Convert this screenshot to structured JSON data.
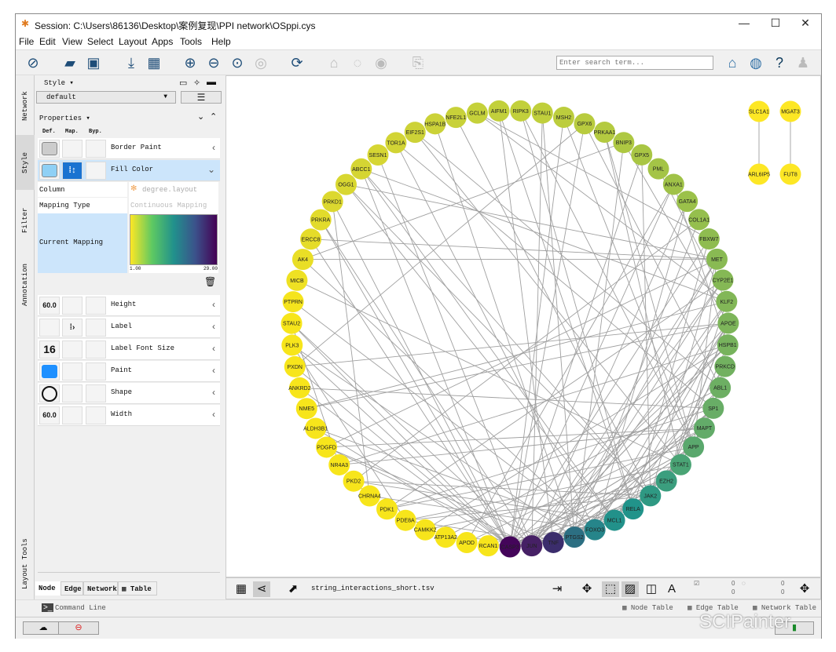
{
  "window": {
    "title": "Session: C:\\Users\\86136\\Desktop\\案例复现\\PPI network\\OSppi.cys",
    "minimize": "—",
    "maximize": "☐",
    "close": "✕"
  },
  "menu": [
    "File",
    "Edit",
    "View",
    "Select",
    "Layout",
    "Apps",
    "Tools",
    "Help"
  ],
  "search": {
    "placeholder": "Enter search term..."
  },
  "side_tabs": [
    "Network",
    "Style",
    "Filter",
    "Annotation",
    "Layout Tools"
  ],
  "style_panel": {
    "header": "Style ▾",
    "style_name": "default",
    "properties_label": "Properties ▾",
    "col_headers": [
      "Def.",
      "Map.",
      "Byp."
    ],
    "properties": [
      {
        "name": "Border Paint",
        "default": "",
        "default_color": "#cccccc"
      },
      {
        "name": "Fill Color",
        "default": "",
        "default_color": "#8fd0f5",
        "selected": true
      }
    ],
    "mapping": {
      "column_label": "Column",
      "column_value": "degree.layout",
      "type_label": "Mapping Type",
      "type_value": "Continuous Mapping",
      "current_label": "Current Mapping",
      "min": "1.00",
      "max": "29.00",
      "gradient": [
        "#fde725",
        "#5ec962",
        "#21918c",
        "#3b528b",
        "#440154"
      ]
    },
    "properties2": [
      {
        "name": "Height",
        "default": "60.0"
      },
      {
        "name": "Label",
        "default": ""
      },
      {
        "name": "Label Font Size",
        "default": "16"
      },
      {
        "name": "Paint",
        "default": "",
        "default_color": "#1e90ff"
      },
      {
        "name": "Shape",
        "default": ""
      },
      {
        "name": "Width",
        "default": "60.0"
      }
    ],
    "bottom_tabs": [
      "Node",
      "Edge",
      "Network",
      "Table"
    ]
  },
  "network": {
    "edge_color": "#a0a0a0",
    "circle_nodes": [
      {
        "n": "GCLM",
        "c": "#c5d13a"
      },
      {
        "n": "AIFM1",
        "c": "#c2d03b"
      },
      {
        "n": "RIPK3",
        "c": "#c2d03b"
      },
      {
        "n": "STAU1",
        "c": "#c0cf3c"
      },
      {
        "n": "MSH2",
        "c": "#bccd3d"
      },
      {
        "n": "GPX6",
        "c": "#b8cb3e"
      },
      {
        "n": "PRKAA1",
        "c": "#b4ca40"
      },
      {
        "n": "BNIP3",
        "c": "#aec842"
      },
      {
        "n": "GPX5",
        "c": "#a9c644"
      },
      {
        "n": "PML",
        "c": "#a4c446"
      },
      {
        "n": "ANXA1",
        "c": "#a0c248"
      },
      {
        "n": "GATA4",
        "c": "#9bc14a"
      },
      {
        "n": "COL1A1",
        "c": "#95bf4d"
      },
      {
        "n": "FBXW7",
        "c": "#8fbc50"
      },
      {
        "n": "MET",
        "c": "#89ba53"
      },
      {
        "n": "CYP2E1",
        "c": "#85b855"
      },
      {
        "n": "KLF2",
        "c": "#82b757"
      },
      {
        "n": "APOE",
        "c": "#7db55a"
      },
      {
        "n": "HSPB1",
        "c": "#77b35d"
      },
      {
        "n": "PRKCD",
        "c": "#72b160"
      },
      {
        "n": "ABL1",
        "c": "#6daf63"
      },
      {
        "n": "SP1",
        "c": "#68ad66"
      },
      {
        "n": "MAPT",
        "c": "#63ab69"
      },
      {
        "n": "APP",
        "c": "#5aa86d"
      },
      {
        "n": "STAT1",
        "c": "#4aa475"
      },
      {
        "n": "EZH2",
        "c": "#3b9e7e"
      },
      {
        "n": "JAK2",
        "c": "#2f9983"
      },
      {
        "n": "RELA",
        "c": "#21938a"
      },
      {
        "n": "MCL1",
        "c": "#22918a"
      },
      {
        "n": "FOXO3",
        "c": "#26858a"
      },
      {
        "n": "PTGS2",
        "c": "#2c6f82"
      },
      {
        "n": "TNF",
        "c": "#3b2d6c"
      },
      {
        "n": "JUN",
        "c": "#462065"
      },
      {
        "n": "CASP3",
        "c": "#44055a"
      },
      {
        "n": "RCAN1",
        "c": "#f7e51b"
      },
      {
        "n": "APOD",
        "c": "#f7e51b"
      },
      {
        "n": "ATP13A2",
        "c": "#f7e51b"
      },
      {
        "n": "CAMKK2",
        "c": "#f7e51b"
      },
      {
        "n": "PDE8A",
        "c": "#f7e51b"
      },
      {
        "n": "PDK1",
        "c": "#f7e51b"
      },
      {
        "n": "CHRNA4",
        "c": "#f7e51b"
      },
      {
        "n": "PKD2",
        "c": "#f7e51b"
      },
      {
        "n": "NR4A3",
        "c": "#f7e51b"
      },
      {
        "n": "PDGFD",
        "c": "#f7e51b"
      },
      {
        "n": "ALDH3B1",
        "c": "#f7e51b"
      },
      {
        "n": "NME5",
        "c": "#f7e51b"
      },
      {
        "n": "ANKRD2",
        "c": "#f7e51b"
      },
      {
        "n": "PXDN",
        "c": "#f7e51b"
      },
      {
        "n": "PLK3",
        "c": "#f7e51b"
      },
      {
        "n": "STAU2",
        "c": "#f7e51b"
      },
      {
        "n": "PTPRN",
        "c": "#f5e41d"
      },
      {
        "n": "MICB",
        "c": "#eee123"
      },
      {
        "n": "AK4",
        "c": "#e9de26"
      },
      {
        "n": "ERCC8",
        "c": "#e5dc29"
      },
      {
        "n": "PRKRA",
        "c": "#e2db2b"
      },
      {
        "n": "PRKD1",
        "c": "#dcd82f"
      },
      {
        "n": "OGG1",
        "c": "#d8d731"
      },
      {
        "n": "ABCC1",
        "c": "#d5d533"
      },
      {
        "n": "SESN1",
        "c": "#d6d633"
      },
      {
        "n": "TOR1A",
        "c": "#d2d435"
      },
      {
        "n": "EIF2S1",
        "c": "#cdd237"
      },
      {
        "n": "HSPA1B",
        "c": "#cbd238"
      },
      {
        "n": "NFE2L1",
        "c": "#c8d139"
      }
    ],
    "pairs": [
      {
        "a": {
          "n": "SLC1A1",
          "c": "#fde725"
        },
        "b": {
          "n": "ARL6IP5",
          "c": "#fde725"
        }
      },
      {
        "a": {
          "n": "MGAT3",
          "c": "#fde725"
        },
        "b": {
          "n": "FUT8",
          "c": "#fde725"
        }
      }
    ]
  },
  "canvas_toolbar": {
    "file": "string_interactions_short.tsv",
    "sel_nodes": "0",
    "sel_nodes_total": "0",
    "hidden": "0",
    "hidden_total": "0"
  },
  "status": {
    "command_line": "Command Line",
    "node_table": "Node Table",
    "edge_table": "Edge Table",
    "network_table": "Network Table"
  },
  "watermark": "SCIPainter"
}
